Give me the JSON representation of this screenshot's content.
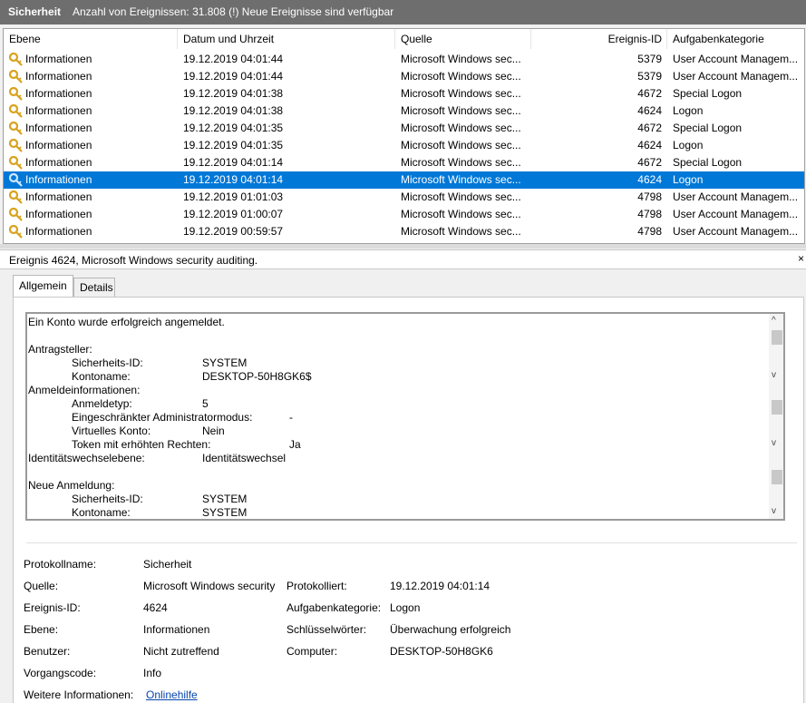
{
  "header": {
    "title": "Sicherheit",
    "status": "Anzahl von Ereignissen: 31.808 (!) Neue Ereignisse sind verfügbar"
  },
  "columns": [
    "Ebene",
    "Datum und Uhrzeit",
    "Quelle",
    "Ereignis-ID",
    "Aufgabenkategorie"
  ],
  "rows": [
    {
      "level": "Informationen",
      "date": "19.12.2019 04:01:44",
      "source": "Microsoft Windows sec...",
      "id": "5379",
      "category": "User Account Managem..."
    },
    {
      "level": "Informationen",
      "date": "19.12.2019 04:01:44",
      "source": "Microsoft Windows sec...",
      "id": "5379",
      "category": "User Account Managem..."
    },
    {
      "level": "Informationen",
      "date": "19.12.2019 04:01:38",
      "source": "Microsoft Windows sec...",
      "id": "4672",
      "category": "Special Logon"
    },
    {
      "level": "Informationen",
      "date": "19.12.2019 04:01:38",
      "source": "Microsoft Windows sec...",
      "id": "4624",
      "category": "Logon"
    },
    {
      "level": "Informationen",
      "date": "19.12.2019 04:01:35",
      "source": "Microsoft Windows sec...",
      "id": "4672",
      "category": "Special Logon"
    },
    {
      "level": "Informationen",
      "date": "19.12.2019 04:01:35",
      "source": "Microsoft Windows sec...",
      "id": "4624",
      "category": "Logon"
    },
    {
      "level": "Informationen",
      "date": "19.12.2019 04:01:14",
      "source": "Microsoft Windows sec...",
      "id": "4672",
      "category": "Special Logon"
    },
    {
      "level": "Informationen",
      "date": "19.12.2019 04:01:14",
      "source": "Microsoft Windows sec...",
      "id": "4624",
      "category": "Logon",
      "selected": true
    },
    {
      "level": "Informationen",
      "date": "19.12.2019 01:01:03",
      "source": "Microsoft Windows sec...",
      "id": "4798",
      "category": "User Account Managem..."
    },
    {
      "level": "Informationen",
      "date": "19.12.2019 01:00:07",
      "source": "Microsoft Windows sec...",
      "id": "4798",
      "category": "User Account Managem..."
    },
    {
      "level": "Informationen",
      "date": "19.12.2019 00:59:57",
      "source": "Microsoft Windows sec...",
      "id": "4798",
      "category": "User Account Managem..."
    }
  ],
  "detail": {
    "header": "Ereignis 4624, Microsoft Windows security auditing.",
    "close": "×",
    "tabs": [
      "Allgemein",
      "Details"
    ],
    "description": [
      {
        "indent": 0,
        "label": "Ein Konto wurde erfolgreich angemeldet.",
        "value": ""
      },
      {
        "indent": 0,
        "label": "",
        "value": ""
      },
      {
        "indent": 0,
        "label": "Antragsteller:",
        "value": ""
      },
      {
        "indent": 1,
        "label": "Sicherheits-ID:",
        "value": "SYSTEM"
      },
      {
        "indent": 1,
        "label": "Kontoname:",
        "value": "DESKTOP-50H8GK6$"
      },
      {
        "indent": 0,
        "label": "Anmeldeinformationen:",
        "value": ""
      },
      {
        "indent": 1,
        "label": "Anmeldetyp:",
        "value": "5"
      },
      {
        "indent": 1,
        "label": "Eingeschränkter Administratormodus:",
        "value": "-",
        "wide": true
      },
      {
        "indent": 1,
        "label": "Virtuelles Konto:",
        "value": "Nein"
      },
      {
        "indent": 1,
        "label": "Token mit erhöhten Rechten:",
        "value": "Ja",
        "wide": true
      },
      {
        "indent": 0,
        "label": "Identitätswechselebene:",
        "value": "Identitätswechsel"
      },
      {
        "indent": 0,
        "label": "",
        "value": ""
      },
      {
        "indent": 0,
        "label": "Neue Anmeldung:",
        "value": ""
      },
      {
        "indent": 1,
        "label": "Sicherheits-ID:",
        "value": "SYSTEM"
      },
      {
        "indent": 1,
        "label": "Kontoname:",
        "value": "SYSTEM"
      }
    ],
    "scroll_arrows": [
      "^",
      "v"
    ],
    "properties": {
      "protokollname_label": "Protokollname:",
      "protokollname": "Sicherheit",
      "quelle_label": "Quelle:",
      "quelle": "Microsoft Windows security",
      "protokolliert_label": "Protokolliert:",
      "protokolliert": "19.12.2019 04:01:14",
      "ereignisid_label": "Ereignis-ID:",
      "ereignisid": "4624",
      "kategorie_label": "Aufgabenkategorie:",
      "kategorie": "Logon",
      "ebene_label": "Ebene:",
      "ebene": "Informationen",
      "schluessel_label": "Schlüsselwörter:",
      "schluessel": "Überwachung erfolgreich",
      "benutzer_label": "Benutzer:",
      "benutzer": "Nicht zutreffend",
      "computer_label": "Computer:",
      "computer": "DESKTOP-50H8GK6",
      "vorgang_label": "Vorgangscode:",
      "vorgang": "Info",
      "weitere_label": "Weitere Informationen:",
      "weitere": "Onlinehilfe"
    }
  },
  "colors": {
    "selection": "#0078d7",
    "titlebar": "#6e6e6e",
    "key": "#d8a21c"
  }
}
